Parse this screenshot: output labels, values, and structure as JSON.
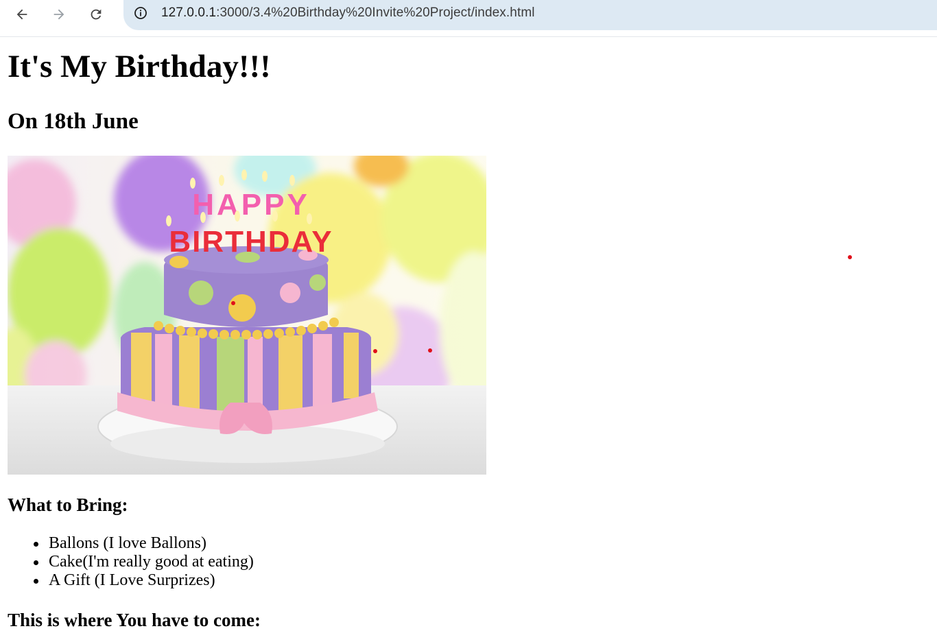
{
  "browser": {
    "url_host": "127.0.0.1",
    "url_path": ":3000/3.4%20Birthday%20Invite%20Project/index.html",
    "icons": [
      "back-arrow-icon",
      "forward-arrow-icon",
      "reload-icon",
      "site-info-icon"
    ]
  },
  "page": {
    "title": "It's My Birthday!!!",
    "date": "On 18th June",
    "cake_image": {
      "candle_text_top": "HAPPY",
      "candle_text_bottom": "BIRTHDAY"
    },
    "bring_heading": "What to Bring:",
    "bring_items": [
      "Ballons (I love Ballons)",
      "Cake(I'm really good at eating)",
      "A Gift (I Love Surprizes)"
    ],
    "where_heading": "This is where You have to come:"
  },
  "colors": {
    "toolbar_bg": "#ffffff",
    "omnibox_bg": "#dde9f3",
    "marker_red": "#e0101a"
  }
}
